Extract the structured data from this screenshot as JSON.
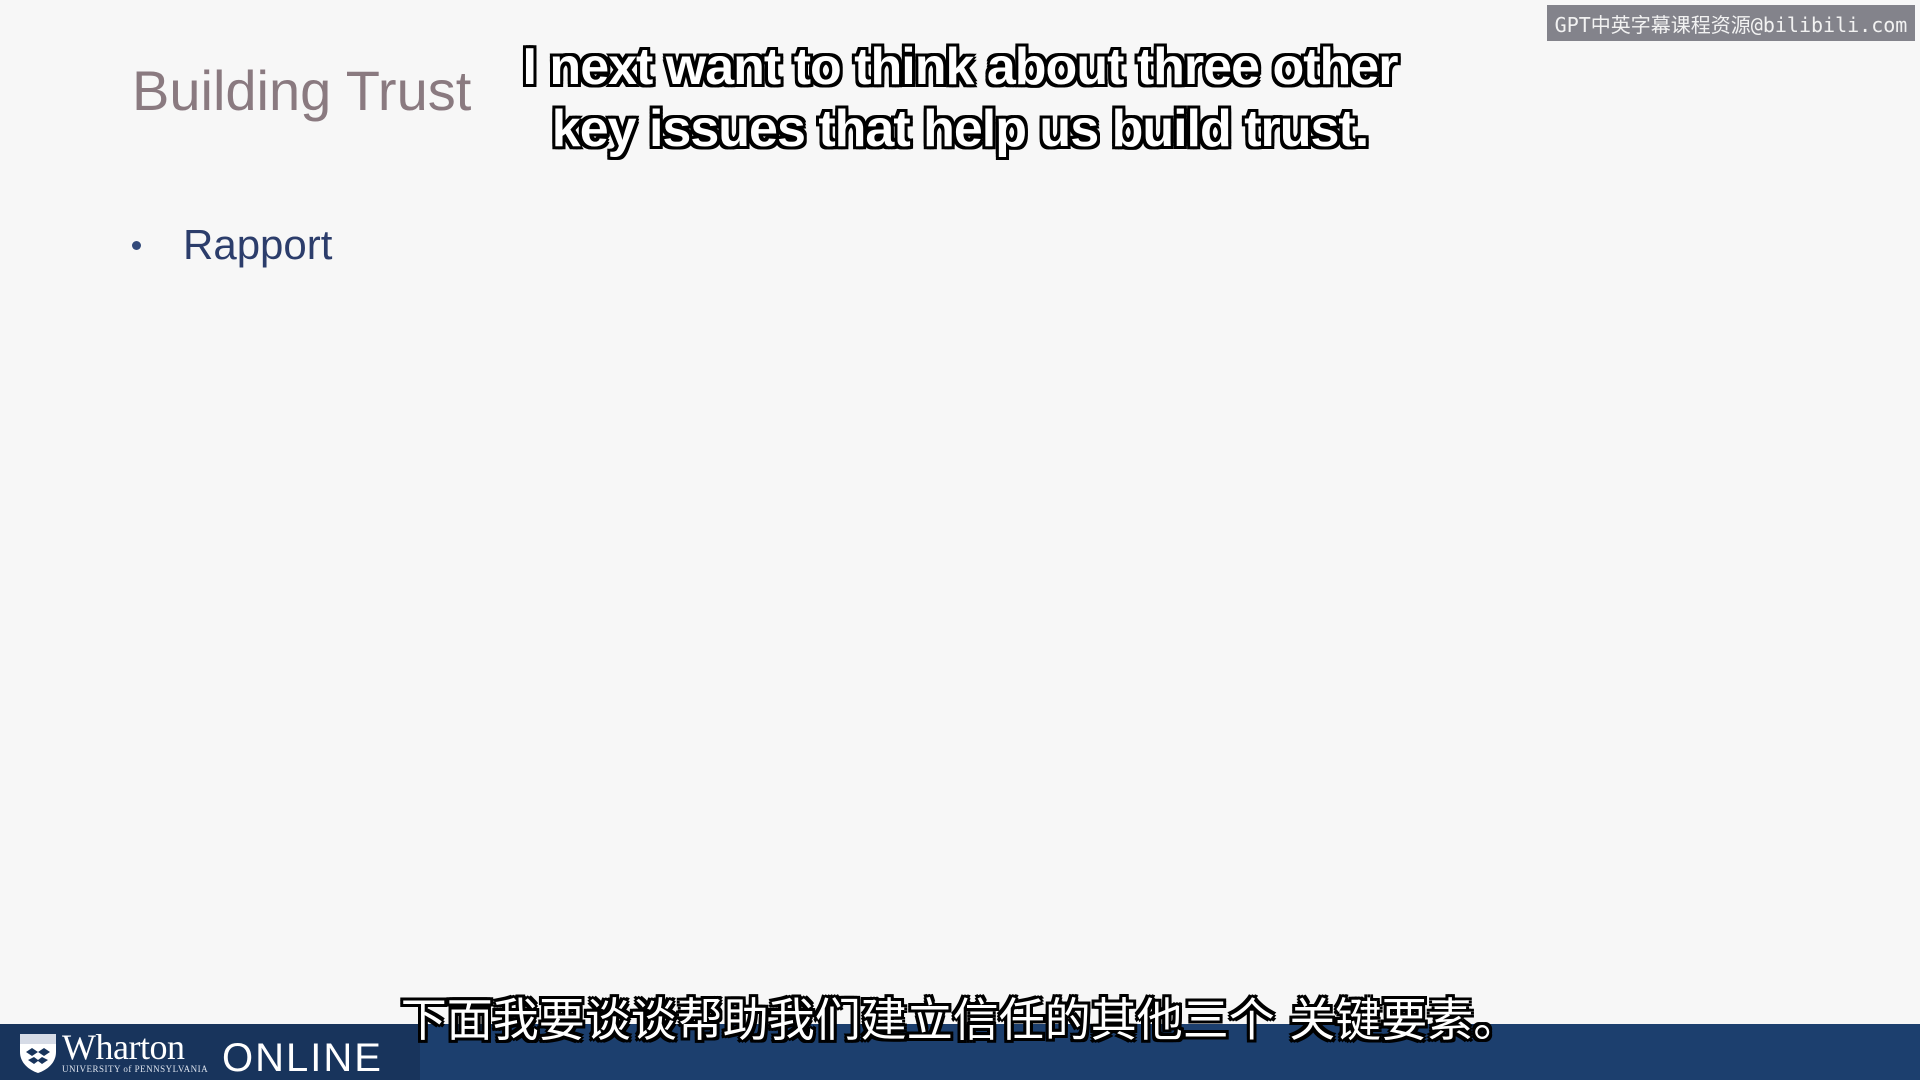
{
  "slide": {
    "title": "Building Trust",
    "bullets": [
      "Rapport"
    ]
  },
  "subtitles": {
    "english_line1": "I next want to think about three other",
    "english_line2": "key issues that help us build trust.",
    "chinese": "下面我要谈谈帮助我们建立信任的其他三个 关键要素。"
  },
  "watermark": {
    "text": "GPT中英字幕课程资源@bilibili.com"
  },
  "footer": {
    "brand": "Wharton",
    "brand_subline": "UNIVERSITY of PENNSYLVANIA",
    "product": "ONLINE",
    "logo_icon": "penn-shield-icon",
    "bar_color": "#1c3f6e"
  },
  "colors": {
    "title": "#8a7a80",
    "bullet_text": "#2c3d6b",
    "background": "#f7f7f7"
  }
}
